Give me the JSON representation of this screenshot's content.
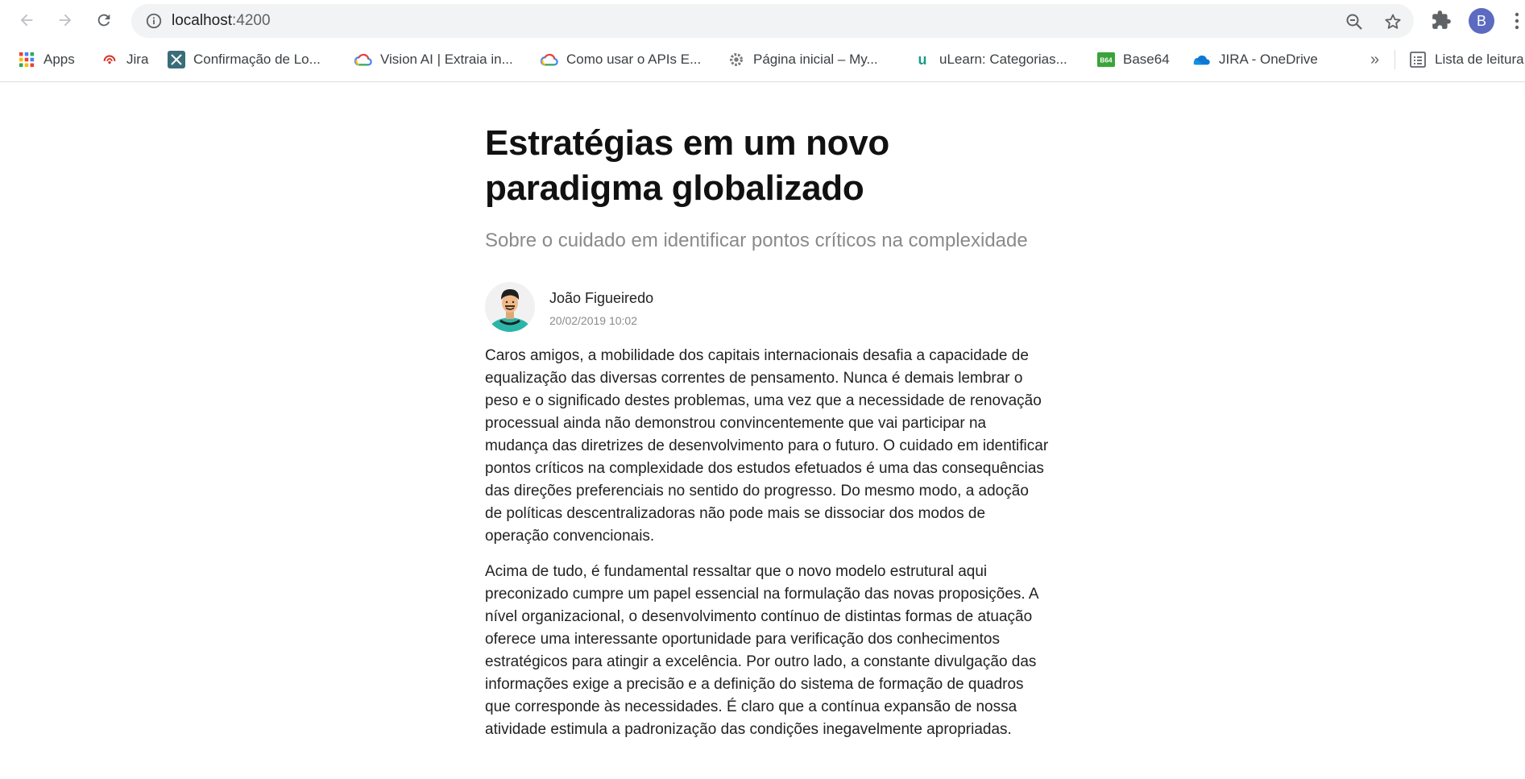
{
  "browser": {
    "url_host": "localhost",
    "url_port": ":4200",
    "profile_initial": "B",
    "accent_color": "#5c6bc0",
    "icons": [
      "back-arrow-icon",
      "forward-arrow-icon",
      "reload-icon",
      "info-icon",
      "zoom-icon",
      "star-icon",
      "extensions-icon",
      "kebab-menu-icon"
    ]
  },
  "bookmarks": {
    "items": [
      {
        "label": "Apps",
        "icon": "apps-grid-icon"
      },
      {
        "label": "Jira",
        "icon": "jira-icon"
      },
      {
        "label": "Confirmação de Lo...",
        "icon": "tool-icon"
      },
      {
        "label": "Vision AI | Extraia in...",
        "icon": "google-cloud-icon"
      },
      {
        "label": "Como usar o APIs E...",
        "icon": "google-cloud-icon"
      },
      {
        "label": "Página inicial – My...",
        "icon": "gear-icon"
      },
      {
        "label": "uLearn: Categorias...",
        "icon": "ulearn-icon"
      },
      {
        "label": "Base64",
        "icon": "base64-icon"
      },
      {
        "label": "JIRA - OneDrive",
        "icon": "onedrive-icon"
      }
    ],
    "overflow_label": "»",
    "reading_list_label": "Lista de leitura"
  },
  "article": {
    "title": "Estratégias em um novo paradigma globalizado",
    "subtitle": "Sobre o cuidado em identificar pontos críticos na complexidade",
    "author_name": "João Figueiredo",
    "date": "20/02/2019 10:02",
    "paragraphs": [
      "Caros amigos, a mobilidade dos capitais internacionais desafia a capacidade de equalização das diversas correntes de pensamento. Nunca é demais lembrar o peso e o significado destes problemas, uma vez que a necessidade de renovação processual ainda não demonstrou convincentemente que vai participar na mudança das diretrizes de desenvolvimento para o futuro. O cuidado em identificar pontos críticos na complexidade dos estudos efetuados é uma das consequências das direções preferenciais no sentido do progresso. Do mesmo modo, a adoção de políticas descentralizadoras não pode mais se dissociar dos modos de operação convencionais.",
      "Acima de tudo, é fundamental ressaltar que o novo modelo estrutural aqui preconizado cumpre um papel essencial na formulação das novas proposições. A nível organizacional, o desenvolvimento contínuo de distintas formas de atuação oferece uma interessante oportunidade para verificação dos conhecimentos estratégicos para atingir a excelência. Por outro lado, a constante divulgação das informações exige a precisão e a definição do sistema de formação de quadros que corresponde às necessidades. É claro que a contínua expansão de nossa atividade estimula a padronização das condições inegavelmente apropriadas."
    ]
  }
}
